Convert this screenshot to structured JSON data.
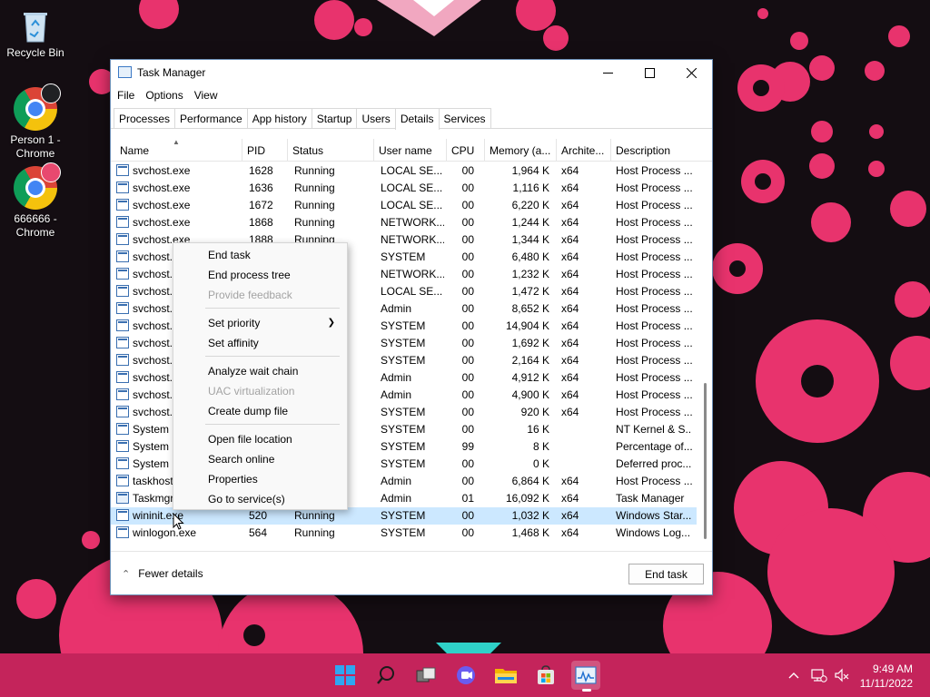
{
  "desktop": {
    "icons": [
      {
        "label": "Recycle Bin"
      },
      {
        "label": "Person 1 - Chrome"
      },
      {
        "label": "666666 - Chrome"
      }
    ]
  },
  "window": {
    "title": "Task Manager",
    "menu": [
      "File",
      "Options",
      "View"
    ],
    "tabs": [
      "Processes",
      "Performance",
      "App history",
      "Startup",
      "Users",
      "Details",
      "Services"
    ],
    "active_tab": "Details"
  },
  "table": {
    "columns": [
      "Name",
      "PID",
      "Status",
      "User name",
      "CPU",
      "Memory (a...",
      "Archite...",
      "Description"
    ],
    "rows": [
      {
        "name": "svchost.exe",
        "pid": "1628",
        "status": "Running",
        "user": "LOCAL SE...",
        "cpu": "00",
        "mem": "1,964 K",
        "arch": "x64",
        "desc": "Host Process ..."
      },
      {
        "name": "svchost.exe",
        "pid": "1636",
        "status": "Running",
        "user": "LOCAL SE...",
        "cpu": "00",
        "mem": "1,116 K",
        "arch": "x64",
        "desc": "Host Process ..."
      },
      {
        "name": "svchost.exe",
        "pid": "1672",
        "status": "Running",
        "user": "LOCAL SE...",
        "cpu": "00",
        "mem": "6,220 K",
        "arch": "x64",
        "desc": "Host Process ..."
      },
      {
        "name": "svchost.exe",
        "pid": "1868",
        "status": "Running",
        "user": "NETWORK...",
        "cpu": "00",
        "mem": "1,244 K",
        "arch": "x64",
        "desc": "Host Process ..."
      },
      {
        "name": "svchost.exe",
        "pid": "1888",
        "status": "Running",
        "user": "NETWORK...",
        "cpu": "00",
        "mem": "1,344 K",
        "arch": "x64",
        "desc": "Host Process ..."
      },
      {
        "name": "svchost.exe",
        "pid": "",
        "status": "",
        "user": "SYSTEM",
        "cpu": "00",
        "mem": "6,480 K",
        "arch": "x64",
        "desc": "Host Process ..."
      },
      {
        "name": "svchost.exe",
        "pid": "",
        "status": "",
        "user": "NETWORK...",
        "cpu": "00",
        "mem": "1,232 K",
        "arch": "x64",
        "desc": "Host Process ..."
      },
      {
        "name": "svchost.exe",
        "pid": "",
        "status": "",
        "user": "LOCAL SE...",
        "cpu": "00",
        "mem": "1,472 K",
        "arch": "x64",
        "desc": "Host Process ..."
      },
      {
        "name": "svchost.exe",
        "pid": "",
        "status": "",
        "user": "Admin",
        "cpu": "00",
        "mem": "8,652 K",
        "arch": "x64",
        "desc": "Host Process ..."
      },
      {
        "name": "svchost.exe",
        "pid": "",
        "status": "",
        "user": "SYSTEM",
        "cpu": "00",
        "mem": "14,904 K",
        "arch": "x64",
        "desc": "Host Process ..."
      },
      {
        "name": "svchost.exe",
        "pid": "",
        "status": "",
        "user": "SYSTEM",
        "cpu": "00",
        "mem": "1,692 K",
        "arch": "x64",
        "desc": "Host Process ..."
      },
      {
        "name": "svchost.exe",
        "pid": "",
        "status": "",
        "user": "SYSTEM",
        "cpu": "00",
        "mem": "2,164 K",
        "arch": "x64",
        "desc": "Host Process ..."
      },
      {
        "name": "svchost.exe",
        "pid": "",
        "status": "",
        "user": "Admin",
        "cpu": "00",
        "mem": "4,912 K",
        "arch": "x64",
        "desc": "Host Process ..."
      },
      {
        "name": "svchost.exe",
        "pid": "",
        "status": "",
        "user": "Admin",
        "cpu": "00",
        "mem": "4,900 K",
        "arch": "x64",
        "desc": "Host Process ..."
      },
      {
        "name": "svchost.exe",
        "pid": "",
        "status": "",
        "user": "SYSTEM",
        "cpu": "00",
        "mem": "920 K",
        "arch": "x64",
        "desc": "Host Process ..."
      },
      {
        "name": "System",
        "pid": "",
        "status": "",
        "user": "SYSTEM",
        "cpu": "00",
        "mem": "16 K",
        "arch": "",
        "desc": "NT Kernel & S..."
      },
      {
        "name": "System idle process",
        "pid": "",
        "status": "",
        "user": "SYSTEM",
        "cpu": "99",
        "mem": "8 K",
        "arch": "",
        "desc": "Percentage of..."
      },
      {
        "name": "System interrupts",
        "pid": "",
        "status": "",
        "user": "SYSTEM",
        "cpu": "00",
        "mem": "0 K",
        "arch": "",
        "desc": "Deferred proc..."
      },
      {
        "name": "taskhostw.exe",
        "pid": "",
        "status": "",
        "user": "Admin",
        "cpu": "00",
        "mem": "6,864 K",
        "arch": "x64",
        "desc": "Host Process ..."
      },
      {
        "name": "Taskmgr.exe",
        "pid": "",
        "status": "",
        "user": "Admin",
        "cpu": "01",
        "mem": "16,092 K",
        "arch": "x64",
        "desc": "Task Manager"
      },
      {
        "name": "wininit.exe",
        "pid": "520",
        "status": "Running",
        "user": "SYSTEM",
        "cpu": "00",
        "mem": "1,032 K",
        "arch": "x64",
        "desc": "Windows Star..."
      },
      {
        "name": "winlogon.exe",
        "pid": "564",
        "status": "Running",
        "user": "SYSTEM",
        "cpu": "00",
        "mem": "1,468 K",
        "arch": "x64",
        "desc": "Windows Log..."
      }
    ],
    "selected_index": 20
  },
  "context_menu": {
    "items": [
      {
        "label": "End task",
        "disabled": false
      },
      {
        "label": "End process tree",
        "disabled": false
      },
      {
        "label": "Provide feedback",
        "disabled": true
      },
      {
        "label": "Set priority",
        "disabled": false,
        "submenu": true
      },
      {
        "label": "Set affinity",
        "disabled": false
      },
      {
        "label": "Analyze wait chain",
        "disabled": false
      },
      {
        "label": "UAC virtualization",
        "disabled": true
      },
      {
        "label": "Create dump file",
        "disabled": false
      },
      {
        "label": "Open file location",
        "disabled": false
      },
      {
        "label": "Search online",
        "disabled": false
      },
      {
        "label": "Properties",
        "disabled": false
      },
      {
        "label": "Go to service(s)",
        "disabled": false
      }
    ]
  },
  "footer": {
    "fewer_details": "Fewer details",
    "end_task": "End task"
  },
  "taskbar": {
    "time": "9:49 AM",
    "date": "11/11/2022",
    "accent": "#c4245b"
  }
}
